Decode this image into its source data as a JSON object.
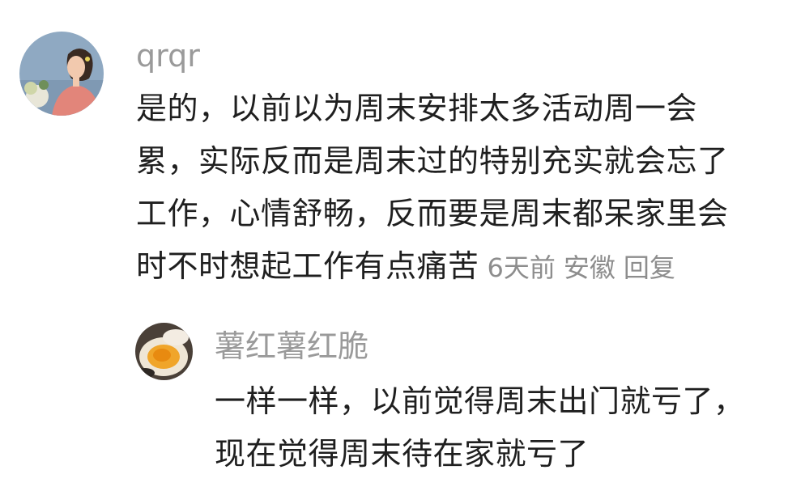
{
  "comments": [
    {
      "username": "qrqr",
      "lines": [
        "是的，以前以为周末安排太多活动周一会",
        "累，实际反而是周末过的特别充实就会忘了",
        "工作，心情舒畅，反而要是周末都呆家里会",
        "时不时想起工作有点痛苦"
      ],
      "time": "6天前",
      "location": "安徽",
      "reply_label": "回复"
    }
  ],
  "replies": [
    {
      "username": "薯红薯红脆",
      "lines": [
        "一样一样，以前觉得周末出门就亏了，",
        "现在觉得周末待在家就亏了"
      ]
    }
  ],
  "colors": {
    "username": "#9a9a9a",
    "text": "#1f1f1f",
    "meta": "#8d8d8d",
    "background": "#ffffff"
  }
}
